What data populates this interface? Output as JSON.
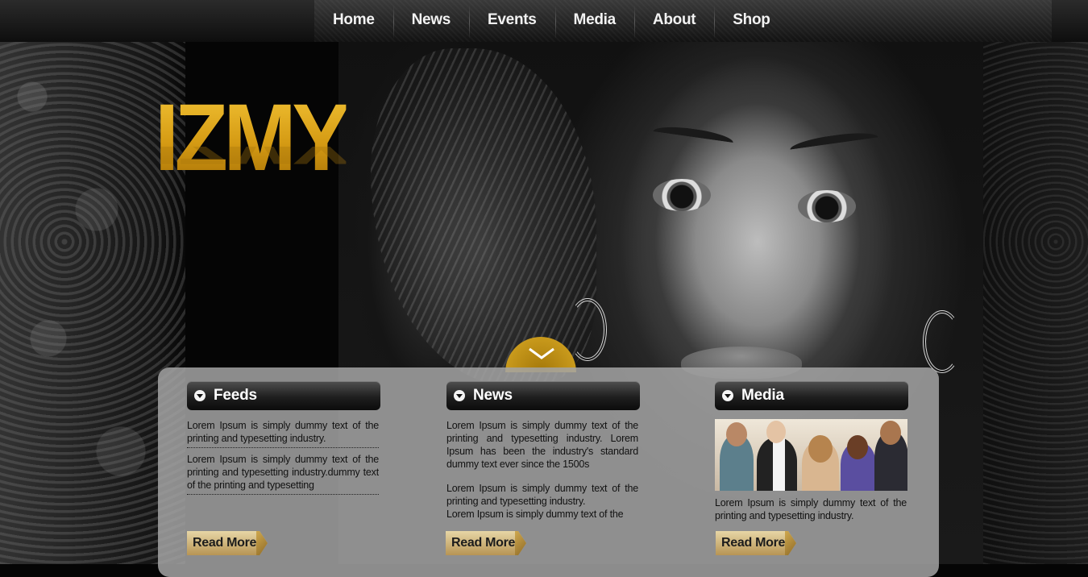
{
  "nav": {
    "items": [
      "Home",
      "News",
      "Events",
      "Media",
      "About",
      "Shop"
    ]
  },
  "brand": {
    "logo": "IZMY"
  },
  "columns": {
    "feeds": {
      "title": "Feeds",
      "paragraphs": [
        "Lorem Ipsum is simply dummy text of the printing and typesetting industry.",
        "Lorem Ipsum is simply dummy text of the printing and typesetting industry.dummy text of the printing and typesetting"
      ],
      "read_more": "Read More"
    },
    "news": {
      "title": "News",
      "paragraphs": [
        "Lorem Ipsum is simply dummy text of the printing and typesetting industry. Lorem Ipsum has been the industry's standard dummy text ever since the 1500s",
        "Lorem Ipsum is simply dummy text of the printing and typesetting industry.",
        "Lorem Ipsum is simply dummy text of the"
      ],
      "read_more": "Read More"
    },
    "media": {
      "title": "Media",
      "caption": "Lorem Ipsum is simply dummy text of the printing and typesetting industry.",
      "read_more": "Read More"
    }
  },
  "colors": {
    "gold": "#d9a620",
    "panel": "#a5a5a5",
    "nav_bg": "#1a1a1a",
    "header_black": "#0b0b0b"
  },
  "icons": {
    "scroll": "chevron-down-icon",
    "section_bullet": "circle-arrow-down-icon"
  }
}
